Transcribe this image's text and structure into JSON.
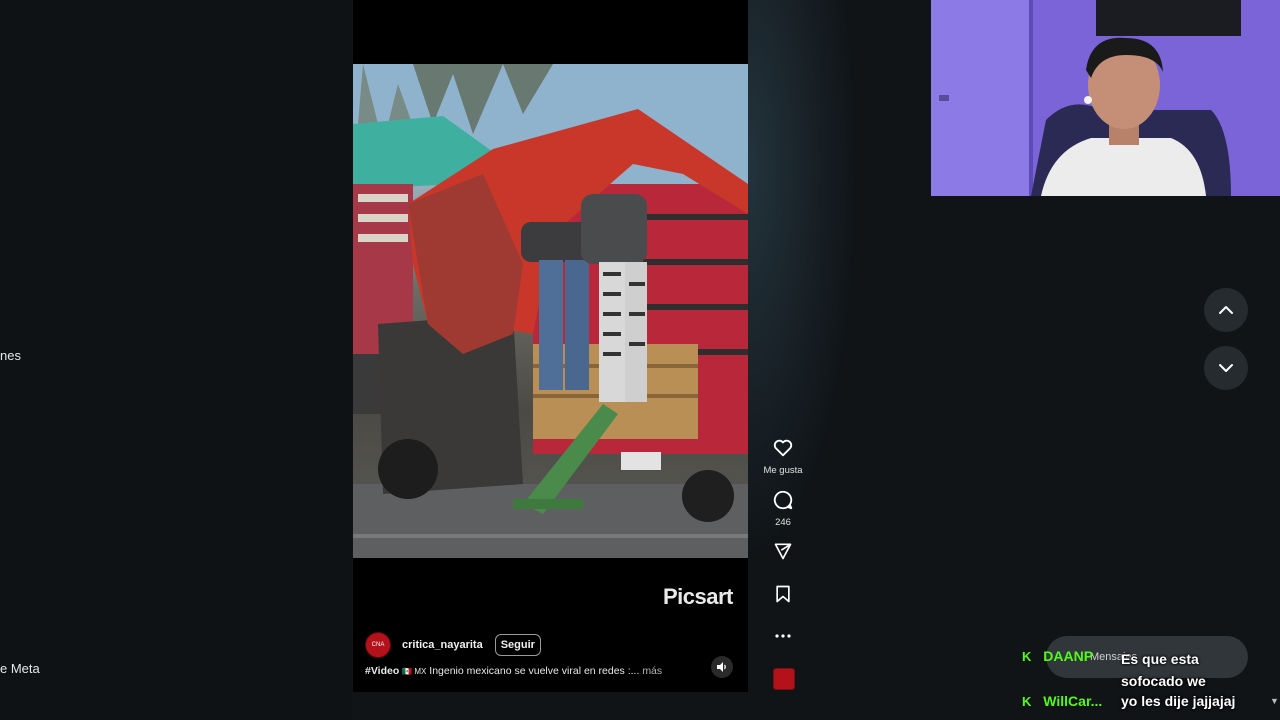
{
  "left_panel": {
    "items": [
      "nes",
      "e Meta"
    ]
  },
  "reel": {
    "watermark": "Picsart",
    "author": {
      "avatar_text": "CNA",
      "username": "critica_nayarita",
      "follow_label": "Seguir"
    },
    "caption": {
      "tag": "#Video",
      "flags": "🇲🇽 MX",
      "text": " Ingenio mexicano se vuelve viral en redes :...",
      "more": "más"
    },
    "mute_icon": "speaker-icon"
  },
  "actions": {
    "like_label": "Me gusta",
    "comments_count": "246",
    "icons": [
      "heart-icon",
      "comment-icon",
      "share-icon",
      "bookmark-icon",
      "more-icon"
    ]
  },
  "nav": {
    "up_icon": "chevron-up-icon",
    "down_icon": "chevron-down-icon"
  },
  "chat": {
    "input_placeholder": "Mensajes",
    "messages": [
      {
        "user": "DAANP",
        "text": "Es que esta sofocado we"
      },
      {
        "user": "WillCar...",
        "text": "yo les dije jajjajaj"
      }
    ]
  },
  "colors": {
    "accent_green": "#53fc18",
    "tarp_red": "#c8372a",
    "brand_red": "#b3121a"
  }
}
